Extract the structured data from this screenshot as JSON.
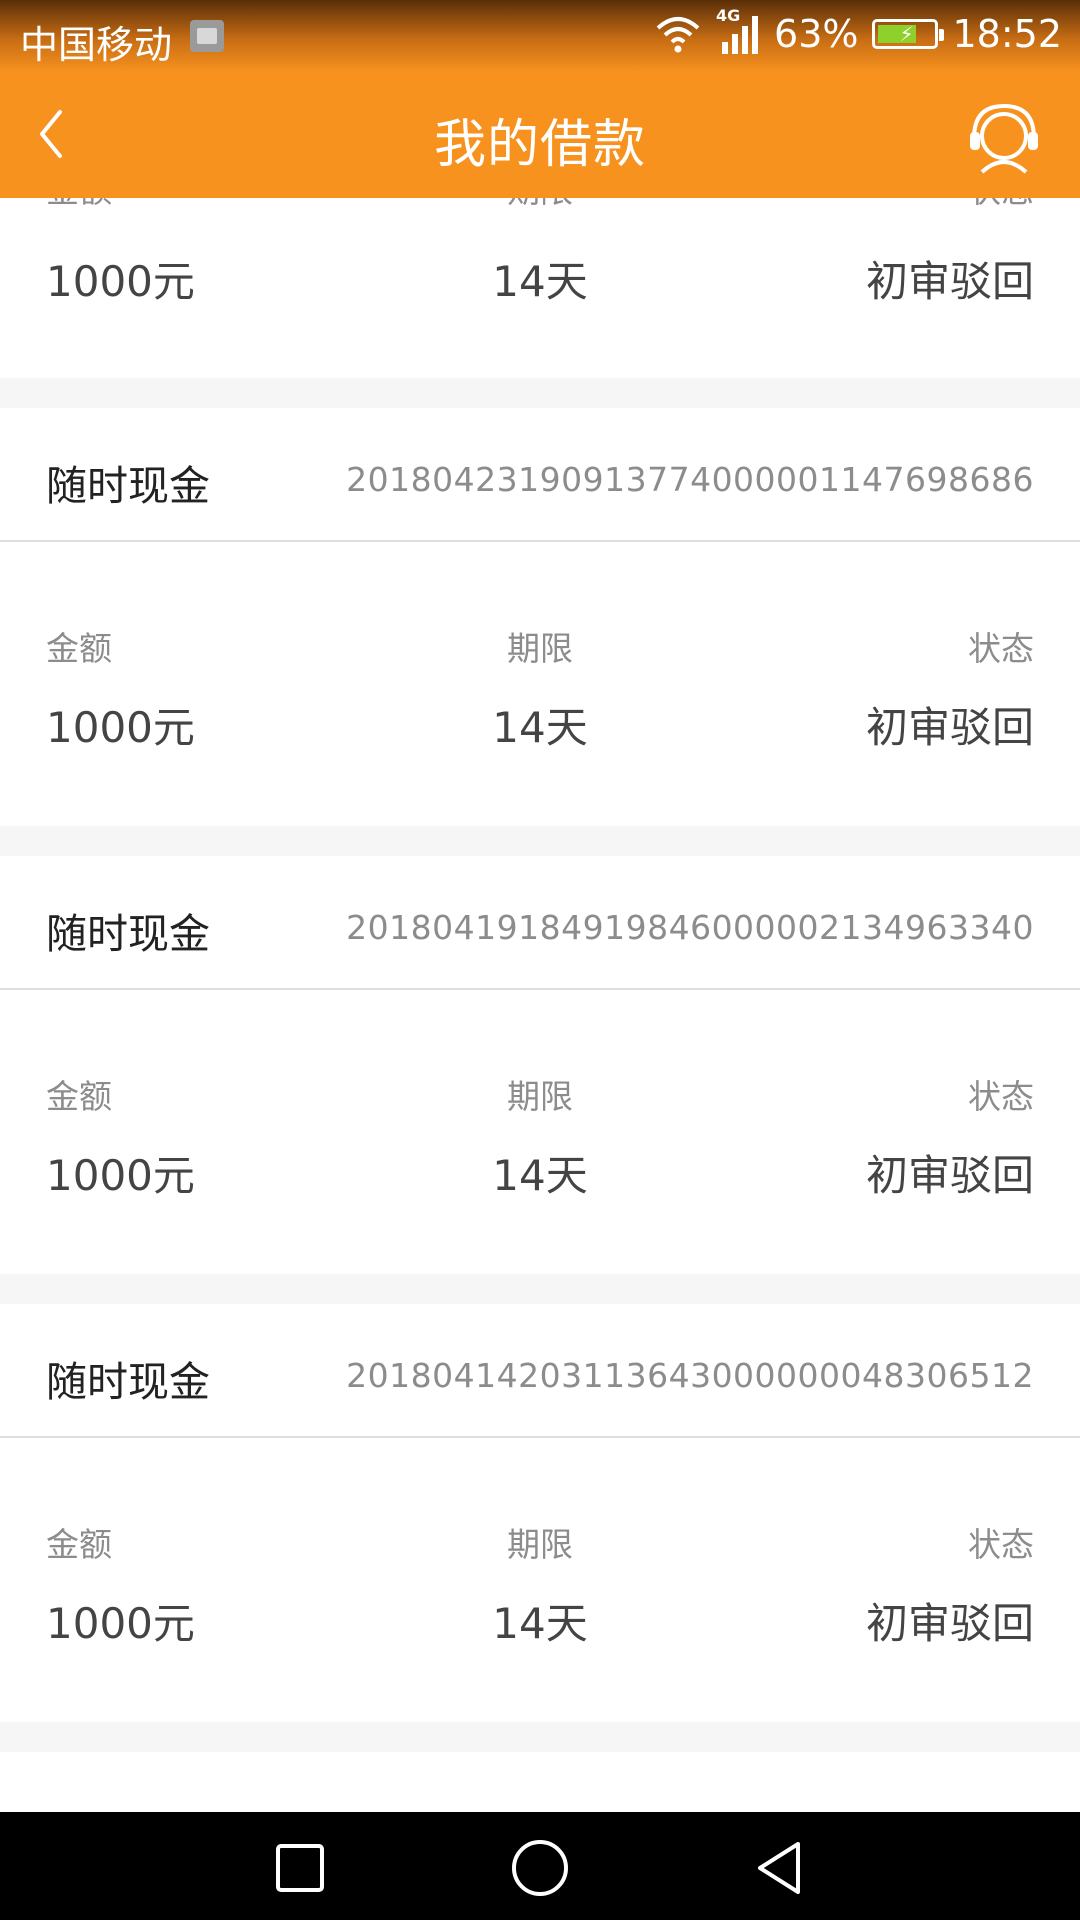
{
  "status_bar": {
    "carrier": "中国移动",
    "network": "4G",
    "battery": "63%",
    "time": "18:52"
  },
  "header": {
    "title": "我的借款"
  },
  "labels": {
    "amount": "金额",
    "term": "期限",
    "status": "状态"
  },
  "partial_loan": {
    "amount": "1000元",
    "term": "14天",
    "status": "初审驳回"
  },
  "loans": [
    {
      "product": "随时现金",
      "order_no": "2018042319091377400000114769868​6",
      "amount": "1000元",
      "term": "14天",
      "status": "初审驳回"
    },
    {
      "product": "随时现金",
      "order_no": "20180419184919846000002134963340",
      "amount": "1000元",
      "term": "14天",
      "status": "初审驳回"
    },
    {
      "product": "随时现金",
      "order_no": "20180414203113643000000048306512",
      "amount": "1000元",
      "term": "14天",
      "status": "初审驳回"
    }
  ],
  "colors": {
    "accent": "#f7921f",
    "background": "#f6f6f6"
  },
  "icons": {
    "back": "back-arrow-icon",
    "support": "customer-service-icon",
    "nav_recent": "square-icon",
    "nav_home": "circle-icon",
    "nav_back": "triangle-icon"
  }
}
